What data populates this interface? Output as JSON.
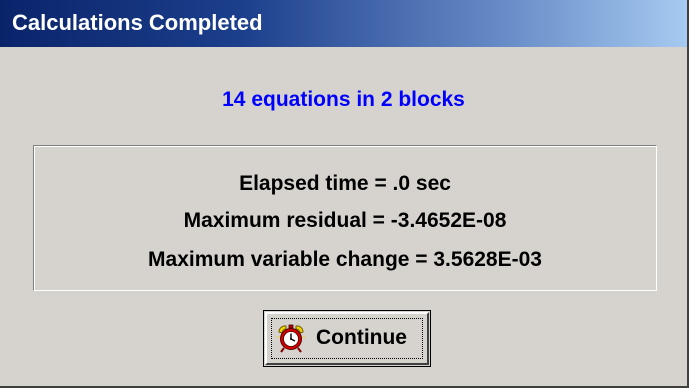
{
  "window": {
    "title": "Calculations Completed"
  },
  "summary": {
    "text": "14 equations in 2 blocks",
    "color": "#0000ff"
  },
  "stats": {
    "elapsed_time": "Elapsed time = .0 sec",
    "max_residual": "Maximum residual = -3.4652E-08",
    "max_variable_change": "Maximum variable change = 3.5628E-03"
  },
  "continue_button": {
    "label": "Continue",
    "icon": "alarm-clock-icon"
  }
}
